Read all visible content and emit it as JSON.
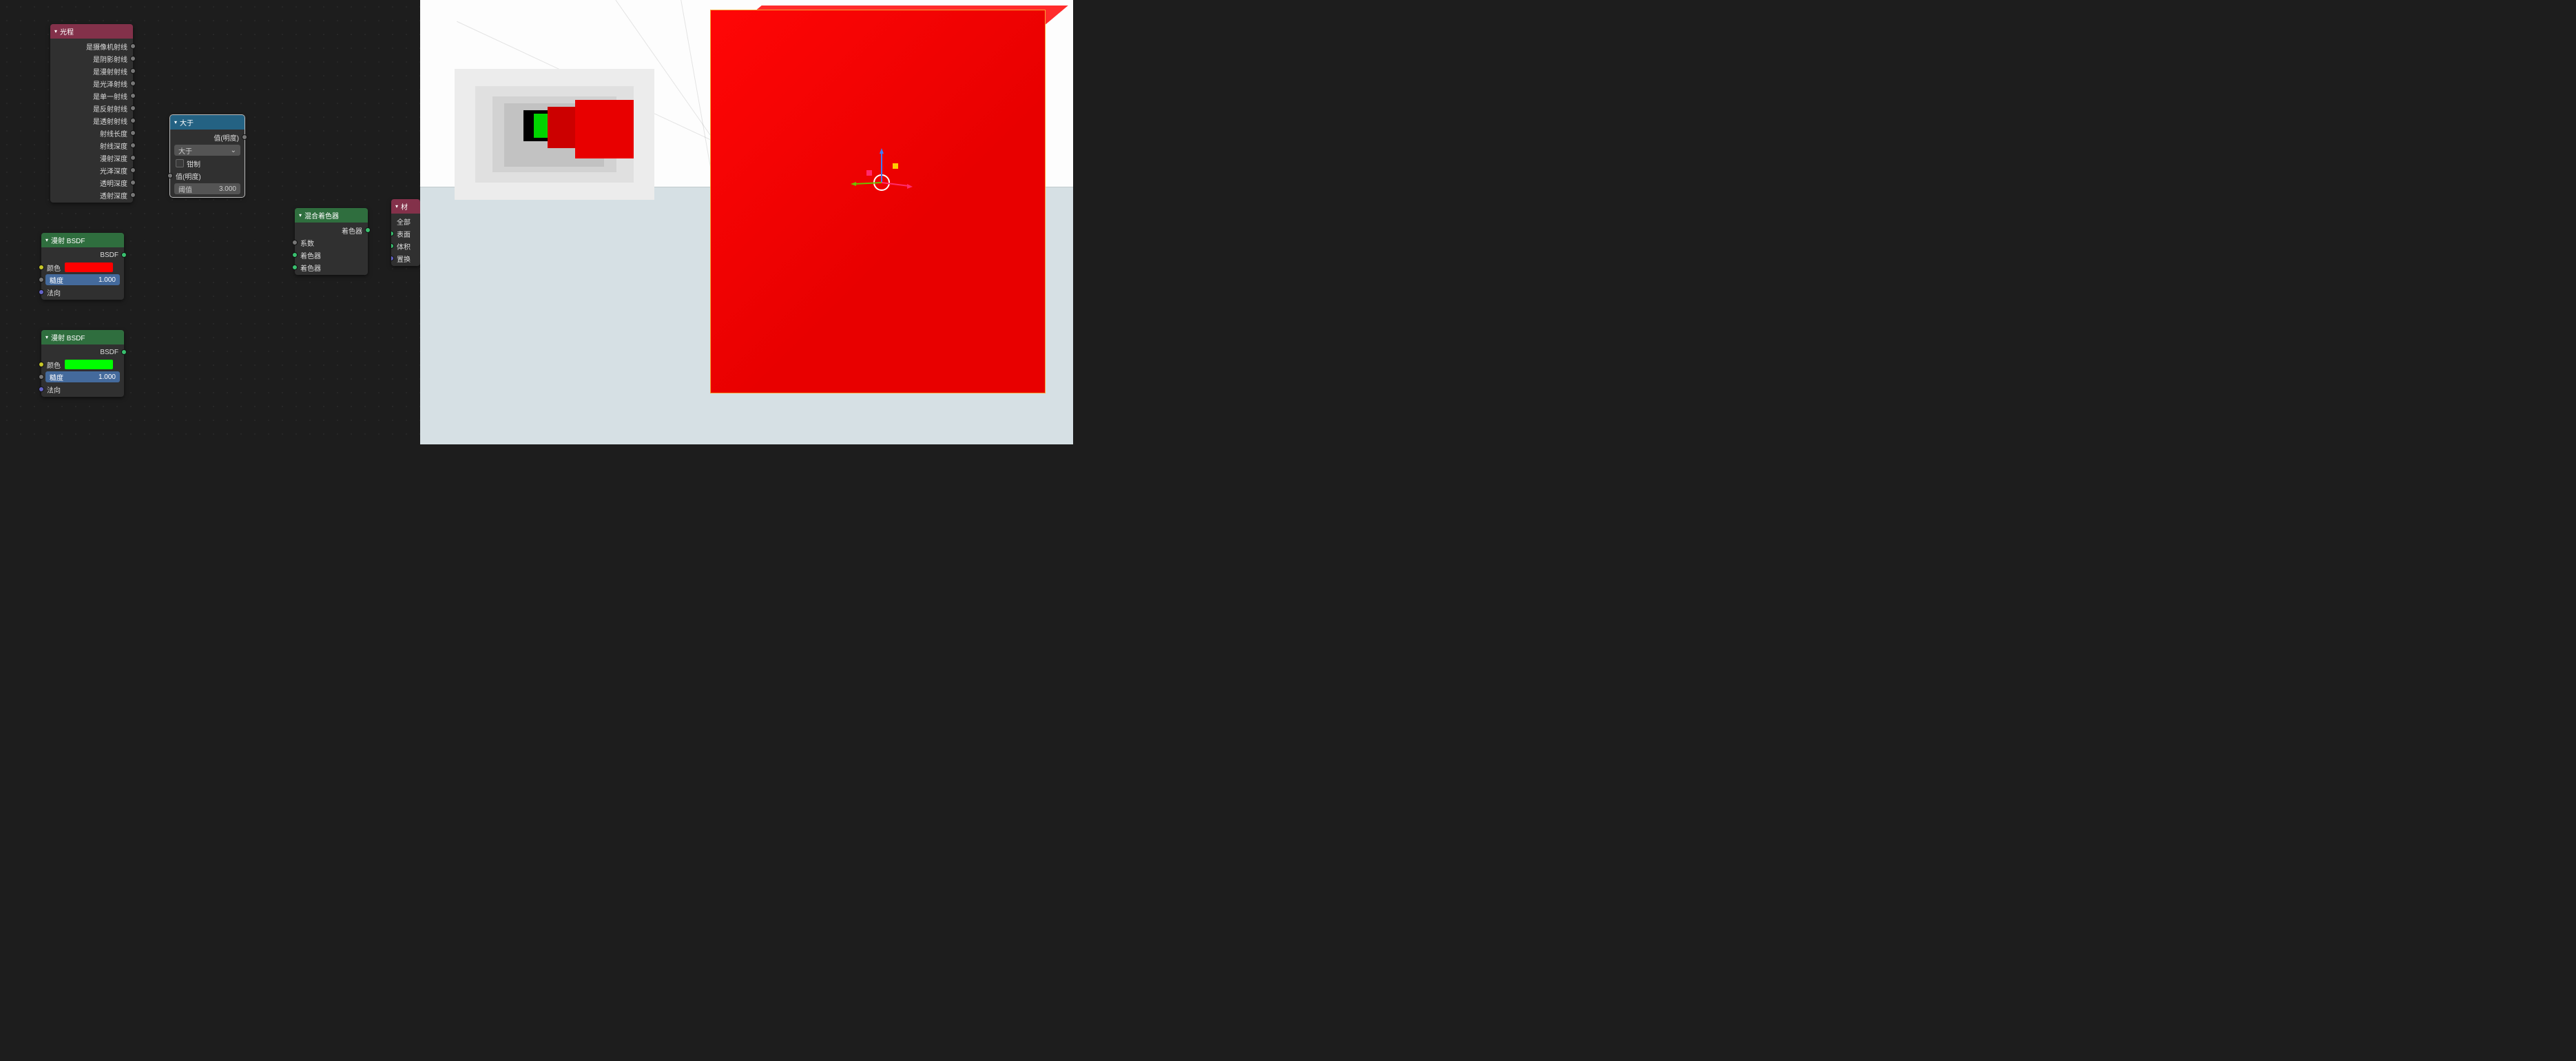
{
  "nodes": {
    "lightpath": {
      "title": "光程",
      "outputs": [
        "是摄像机射线",
        "是阴影射线",
        "是漫射射线",
        "是光泽射线",
        "是单一射线",
        "是反射射线",
        "是透射射线",
        "射线长度",
        "射线深度",
        "漫射深度",
        "光泽深度",
        "透明深度",
        "透射深度"
      ]
    },
    "greater": {
      "title": "大于",
      "output": "值(明度)",
      "op": "大于",
      "clamp": "钳制",
      "value_label": "值(明度)",
      "thresh_label": "阈值",
      "thresh_value": "3.000"
    },
    "diffuse1": {
      "title": "漫射 BSDF",
      "out": "BSDF",
      "color_label": "颜色",
      "rough_label": "糙度",
      "rough_value": "1.000",
      "normal_label": "法向",
      "swatch": "#ff0000"
    },
    "diffuse2": {
      "title": "漫射 BSDF",
      "out": "BSDF",
      "color_label": "颜色",
      "rough_label": "糙度",
      "rough_value": "1.000",
      "normal_label": "法向",
      "swatch": "#00ff00"
    },
    "mix": {
      "title": "混合着色器",
      "out": "着色器",
      "fac": "系数",
      "in1": "着色器",
      "in2": "着色器"
    },
    "output": {
      "title": "材",
      "all": "全部",
      "surface": "表面",
      "volume": "体积",
      "disp": "置换"
    }
  }
}
